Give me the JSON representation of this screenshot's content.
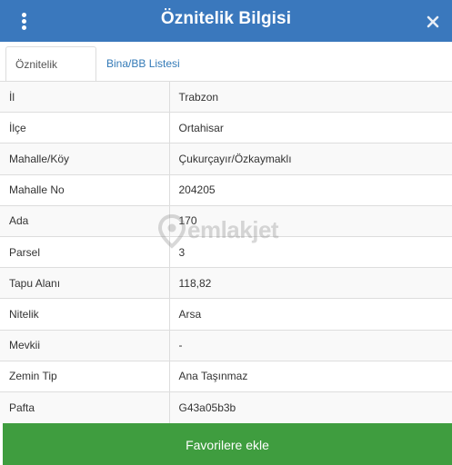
{
  "header": {
    "title": "Öznitelik Bilgisi",
    "menu_icon": "kebab-menu-icon",
    "close_icon": "close-icon",
    "accent_color": "#3a78bd"
  },
  "tabs": [
    {
      "label": "Öznitelik Bilgisi",
      "active": true
    },
    {
      "label": "Bina/BB Listesi",
      "active": false
    }
  ],
  "rows": [
    {
      "key": "İl",
      "value": "Trabzon"
    },
    {
      "key": "İlçe",
      "value": "Ortahisar"
    },
    {
      "key": "Mahalle/Köy",
      "value": "Çukurçayır/Özkaymaklı"
    },
    {
      "key": "Mahalle No",
      "value": "204205"
    },
    {
      "key": "Ada",
      "value": "170"
    },
    {
      "key": "Parsel",
      "value": "3"
    },
    {
      "key": "Tapu Alanı",
      "value": "118,82"
    },
    {
      "key": "Nitelik",
      "value": "Arsa"
    },
    {
      "key": "Mevkii",
      "value": "-"
    },
    {
      "key": "Zemin Tip",
      "value": "Ana Taşınmaz"
    },
    {
      "key": "Pafta",
      "value": "G43a05b3b"
    }
  ],
  "watermark": {
    "text": "emlakjet",
    "icon": "location-pin-icon"
  },
  "footer": {
    "button_label": "Favorilere ekle",
    "button_color": "#3f9d3f"
  }
}
